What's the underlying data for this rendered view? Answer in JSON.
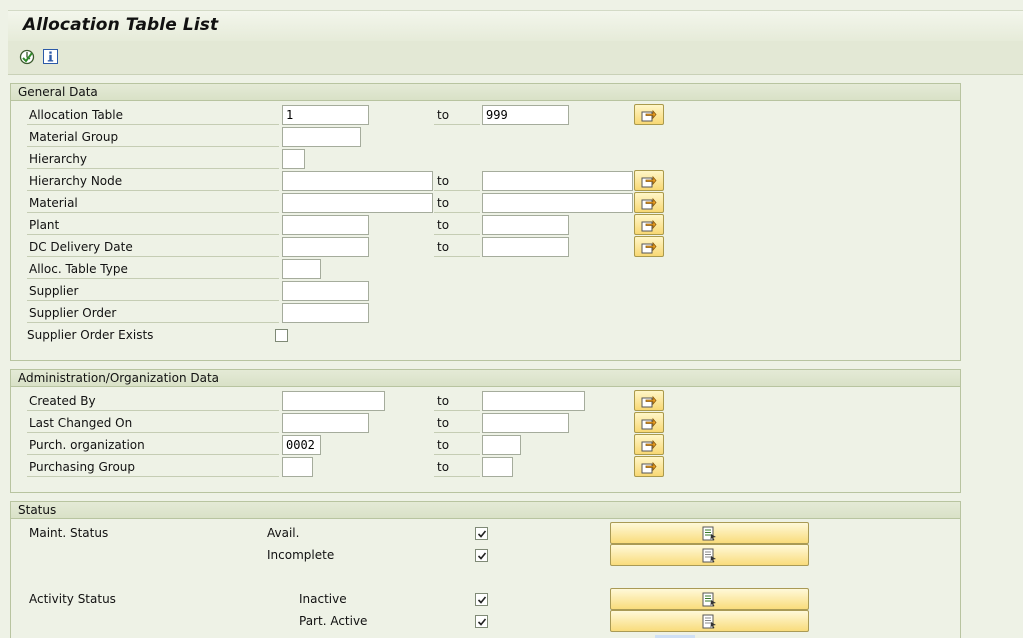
{
  "window": {
    "title": "Allocation Table List"
  },
  "toolbar": {
    "icons": [
      "execute-icon",
      "info-icon"
    ]
  },
  "general": {
    "header": "General Data",
    "to_label": "to",
    "rows": [
      {
        "label": "Allocation Table",
        "from": "1",
        "to": "999"
      },
      {
        "label": "Material Group",
        "from": ""
      },
      {
        "label": "Hierarchy",
        "from": ""
      },
      {
        "label": "Hierarchy Node",
        "from": "",
        "to": ""
      },
      {
        "label": "Material",
        "from": "",
        "to": ""
      },
      {
        "label": "Plant",
        "from": "",
        "to": ""
      },
      {
        "label": "DC Delivery Date",
        "from": "",
        "to": ""
      },
      {
        "label": "Alloc. Table Type",
        "from": ""
      },
      {
        "label": "Supplier",
        "from": ""
      },
      {
        "label": "Supplier Order",
        "from": ""
      },
      {
        "label": "Supplier Order Exists",
        "checked": false
      }
    ]
  },
  "admin": {
    "header": "Administration/Organization Data",
    "to_label": "to",
    "rows": [
      {
        "label": "Created By",
        "from": "",
        "to": ""
      },
      {
        "label": "Last Changed On",
        "from": "",
        "to": ""
      },
      {
        "label": "Purch. organization",
        "from": "0002",
        "to": ""
      },
      {
        "label": "Purchasing Group",
        "from": "",
        "to": ""
      }
    ]
  },
  "status": {
    "header": "Status",
    "maint_label": "Maint. Status",
    "activity_label": "Activity Status",
    "options": [
      {
        "label": "Avail.",
        "checked": true
      },
      {
        "label": "Incomplete",
        "checked": true
      },
      {
        "label": "Inactive",
        "checked": true
      },
      {
        "label": "Part. Active",
        "checked": true
      }
    ]
  }
}
